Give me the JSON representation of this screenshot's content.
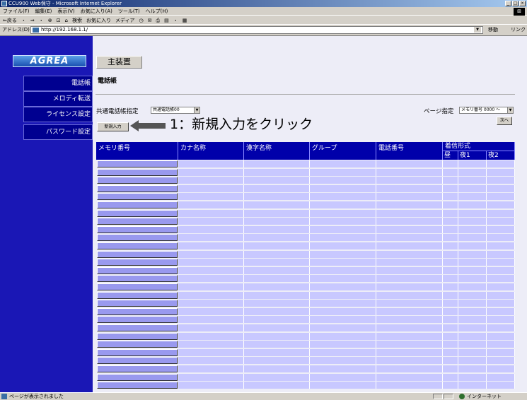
{
  "window": {
    "title": "CCU900 Web保守 - Microsoft Internet Explorer",
    "min": "_",
    "max": "□",
    "close": "×"
  },
  "menu": [
    "ファイル(F)",
    "編集(E)",
    "表示(V)",
    "お気に入り(A)",
    "ツール(T)",
    "ヘルプ(H)"
  ],
  "toolbar": [
    "⇐戻る",
    "・",
    "⇒",
    "・",
    "⊗",
    "⊡",
    "⌂",
    "検索",
    "お気に入り",
    "メディア",
    "◷",
    "✉",
    "⎙",
    "▤",
    "・",
    "▦"
  ],
  "address": {
    "label": "アドレス(D)",
    "url": "http://192.168.1.1/",
    "go": "移動",
    "links": "リンク »"
  },
  "logo": "AGREA",
  "sidebar": {
    "items": [
      {
        "label": "電話帳"
      },
      {
        "label": "メロディ転送"
      },
      {
        "label": "ライセンス設定"
      },
      {
        "label": "パスワード設定"
      }
    ]
  },
  "tab": {
    "label": "主装置"
  },
  "page_title": "電話帳",
  "common": {
    "label": "共通電話帳指定",
    "value": "共通電話帳00"
  },
  "page_select": {
    "label": "ページ指定",
    "value": "メモリ番号 0000 ～",
    "next": "次へ"
  },
  "new_button": "新規入力",
  "annotation": "1：新規入力をクリック",
  "table": {
    "headers": [
      "メモリ番号",
      "カナ名称",
      "漢字名称",
      "グループ",
      "電話番号"
    ],
    "ring_header": "着信形式",
    "ring_sub": [
      "昼",
      "夜1",
      "夜2"
    ],
    "row_count": 28
  },
  "status": {
    "message": "ページが表示されました",
    "zone": "インターネット"
  },
  "colors": {
    "sidebar": "#1a17b5",
    "header": "#0000aa",
    "cell": "#c8c8ff"
  }
}
